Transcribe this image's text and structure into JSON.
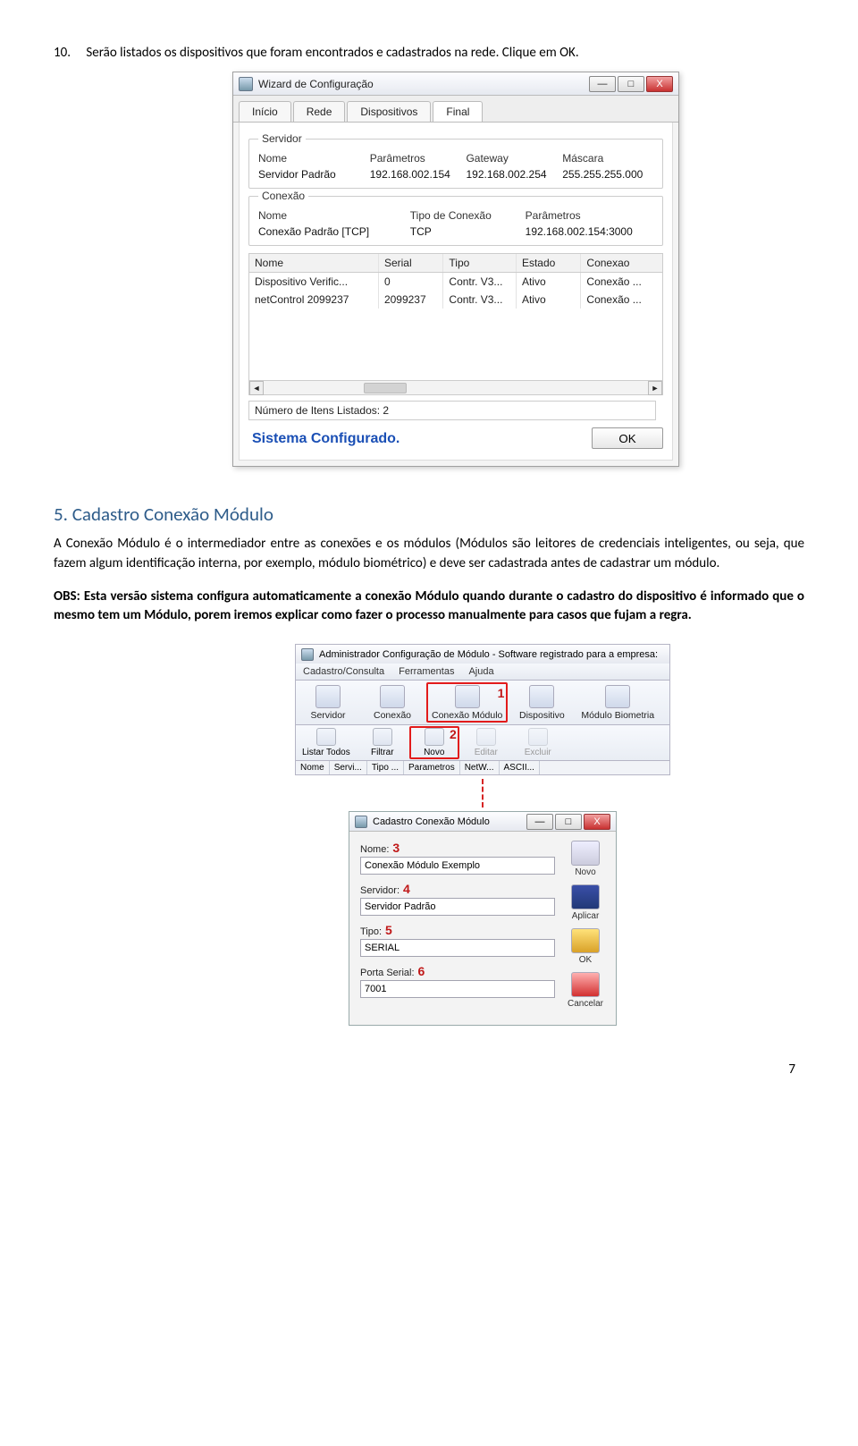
{
  "step": {
    "num": "10.",
    "text": "Serão listados os dispositivos que foram encontrados e cadastrados na rede. Clique em OK."
  },
  "wizard": {
    "title": "Wizard de Configuração",
    "win_buttons": {
      "min": "—",
      "max": "□",
      "close": "X"
    },
    "tabs": [
      "Início",
      "Rede",
      "Dispositivos",
      "Final"
    ],
    "active_tab": 3,
    "servidor": {
      "legend": "Servidor",
      "head": [
        "Nome",
        "Parâmetros",
        "Gateway",
        "Máscara"
      ],
      "row": [
        "Servidor Padrão",
        "192.168.002.154",
        "192.168.002.254",
        "255.255.255.000"
      ]
    },
    "conexao": {
      "legend": "Conexão",
      "head": [
        "Nome",
        "Tipo de Conexão",
        "Parâmetros"
      ],
      "row": [
        "Conexão Padrão [TCP]",
        "TCP",
        "192.168.002.154:3000"
      ]
    },
    "grid": {
      "head": [
        "Nome",
        "Serial",
        "Tipo",
        "Estado",
        "Conexao"
      ],
      "rows": [
        [
          "Dispositivo Verific...",
          "0",
          "Contr. V3...",
          "Ativo",
          "Conexão ..."
        ],
        [
          "netControl 2099237",
          "2099237",
          "Contr. V3...",
          "Ativo",
          "Conexão ..."
        ]
      ]
    },
    "count_label": "Número de Itens Listados: 2",
    "status": "Sistema Configurado.",
    "ok": "OK"
  },
  "section": {
    "num": "5.",
    "title": "Cadastro Conexão Módulo",
    "para": "A Conexão Módulo é o intermediador entre as conexões e os módulos (Módulos são leitores de credenciais inteligentes, ou seja, que fazem algum identificação interna, por exemplo, módulo biométrico) e deve ser cadastrada antes de cadastrar um módulo.",
    "obs_lead": "OBS: Esta versão sistema configura automaticamente a conexão Módulo quando durante o cadastro do dispositivo é informado que o mesmo tem um Módulo, porem iremos explicar como fazer o processo manualmente para casos que fujam a regra."
  },
  "admin": {
    "title": "Administrador Configuração de Módulo - Software registrado para a empresa:",
    "menu": [
      "Cadastro/Consulta",
      "Ferramentas",
      "Ajuda"
    ],
    "toolbar": [
      {
        "label": "Servidor"
      },
      {
        "label": "Conexão"
      },
      {
        "label": "Conexão Módulo"
      },
      {
        "label": "Dispositivo"
      },
      {
        "label": "Módulo Biometria"
      }
    ],
    "toolbar2": [
      {
        "label": "Listar Todos"
      },
      {
        "label": "Filtrar"
      },
      {
        "label": "Novo"
      },
      {
        "label": "Editar",
        "disabled": true
      },
      {
        "label": "Excluir",
        "disabled": true
      }
    ],
    "tabs2": [
      "Nome",
      "Servi...",
      "Tipo ...",
      "Parametros",
      "NetW...",
      "ASCII..."
    ],
    "callouts": {
      "c1": "1",
      "c2": "2"
    }
  },
  "dlg": {
    "title": "Cadastro Conexão Módulo",
    "nome": {
      "label": "Nome:",
      "value": "Conexão Módulo Exemplo",
      "num": "3"
    },
    "servidor": {
      "label": "Servidor:",
      "value": "Servidor Padrão",
      "num": "4"
    },
    "tipo": {
      "label": "Tipo:",
      "value": "SERIAL",
      "num": "5"
    },
    "porta": {
      "label": "Porta Serial:",
      "value": "7001",
      "num": "6"
    },
    "side": {
      "novo": "Novo",
      "aplicar": "Aplicar",
      "ok": "OK",
      "cancelar": "Cancelar"
    }
  },
  "page": "7"
}
